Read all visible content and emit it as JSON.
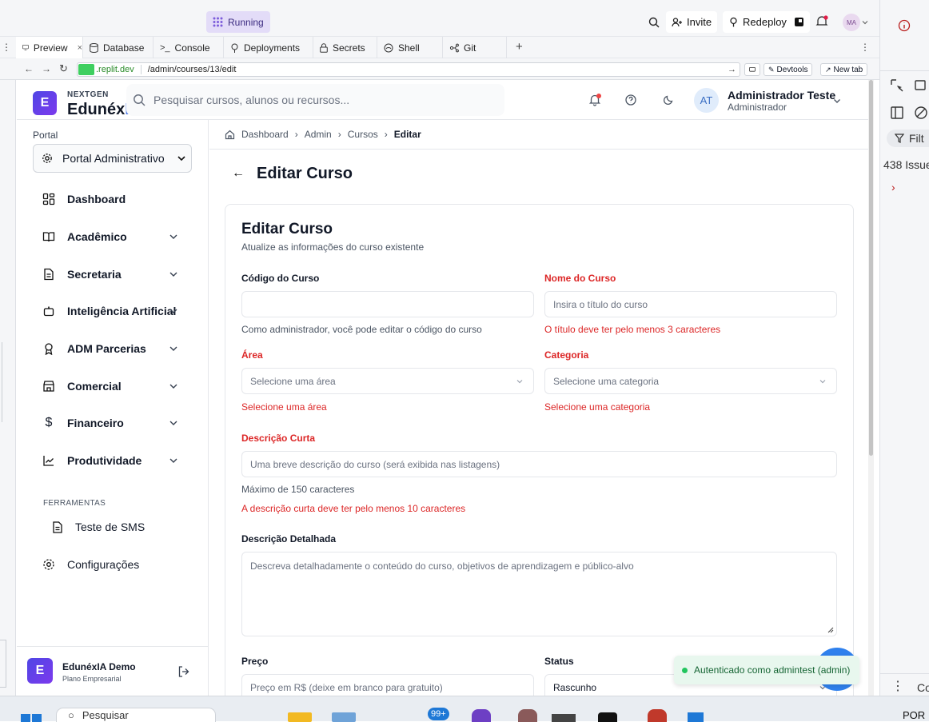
{
  "replit": {
    "status": "Running",
    "invite": "Invite",
    "redeploy": "Redeploy",
    "avatar": "MA",
    "tabs": [
      "Preview",
      "Database",
      "Console",
      "Deployments",
      "Secrets",
      "Shell",
      "Git"
    ],
    "url_host": ".replit.dev",
    "url_path": "/admin/courses/13/edit",
    "devtools": "Devtools",
    "new_tab": "New tab"
  },
  "devpanel": {
    "filter": "Filt",
    "issues": "438 Issue",
    "bottom": "Co"
  },
  "brand": {
    "tag": "NEXTGEN",
    "name_main": "Edunéx",
    "name_accent": "IA",
    "logo_letter": "E"
  },
  "header": {
    "search_placeholder": "Pesquisar cursos, alunos ou recursos...",
    "user_initials": "AT",
    "user_name": "Administrador Teste",
    "user_role": "Administrador"
  },
  "sidebar": {
    "portal_label": "Portal",
    "portal_select": "Portal Administrativo",
    "items": [
      {
        "label": "Dashboard",
        "icon": "dashboard-icon",
        "chevron": false
      },
      {
        "label": "Acadêmico",
        "icon": "book-icon",
        "chevron": true
      },
      {
        "label": "Secretaria",
        "icon": "document-icon",
        "chevron": true
      },
      {
        "label": "Inteligência Artificial",
        "icon": "bot-icon",
        "chevron": true
      },
      {
        "label": "ADM Parcerias",
        "icon": "award-icon",
        "chevron": true
      },
      {
        "label": "Comercial",
        "icon": "store-icon",
        "chevron": true
      },
      {
        "label": "Financeiro",
        "icon": "dollar-icon",
        "chevron": true
      },
      {
        "label": "Produtividade",
        "icon": "chart-line-icon",
        "chevron": true
      }
    ],
    "tools_heading": "FERRAMENTAS",
    "tools": [
      {
        "label": "Teste de SMS"
      }
    ],
    "settings": "Configurações",
    "footer_name": "EdunéxIA Demo",
    "footer_plan": "Plano Empresarial",
    "footer_letter": "E"
  },
  "breadcrumb": [
    "Dashboard",
    "Admin",
    "Cursos",
    "Editar"
  ],
  "page": {
    "title": "Editar Curso",
    "card_title": "Editar Curso",
    "card_subtitle": "Atualize as informações do curso existente"
  },
  "form": {
    "code_label": "Código do Curso",
    "code_value": "",
    "code_hint": "Como administrador, você pode editar o código do curso",
    "name_label": "Nome do Curso",
    "name_placeholder": "Insira o título do curso",
    "name_error": "O título deve ter pelo menos 3 caracteres",
    "area_label": "Área",
    "area_placeholder": "Selecione uma área",
    "area_error": "Selecione uma área",
    "category_label": "Categoria",
    "category_placeholder": "Selecione uma categoria",
    "category_error": "Selecione uma categoria",
    "short_label": "Descrição Curta",
    "short_placeholder": "Uma breve descrição do curso (será exibida nas listagens)",
    "short_hint": "Máximo de 150 caracteres",
    "short_error": "A descrição curta deve ter pelo menos 10 caracteres",
    "long_label": "Descrição Detalhada",
    "long_placeholder": "Descreva detalhadamente o conteúdo do curso, objetivos de aprendizagem e público-alvo",
    "price_label": "Preço",
    "price_placeholder": "Preço em R$ (deixe em branco para gratuito)",
    "status_label": "Status",
    "status_value": "Rascunho"
  },
  "toast": "Autenticado como admintest (admin)",
  "taskbar": {
    "search": "Pesquisar",
    "badge": "99+",
    "lang": "POR"
  },
  "colors": {
    "brand": "#4f46e5",
    "accent_gradient": "#7c3aed",
    "error": "#dc2626",
    "toast_bg": "#e8f7ee",
    "running_bg": "#e3dcf8"
  }
}
